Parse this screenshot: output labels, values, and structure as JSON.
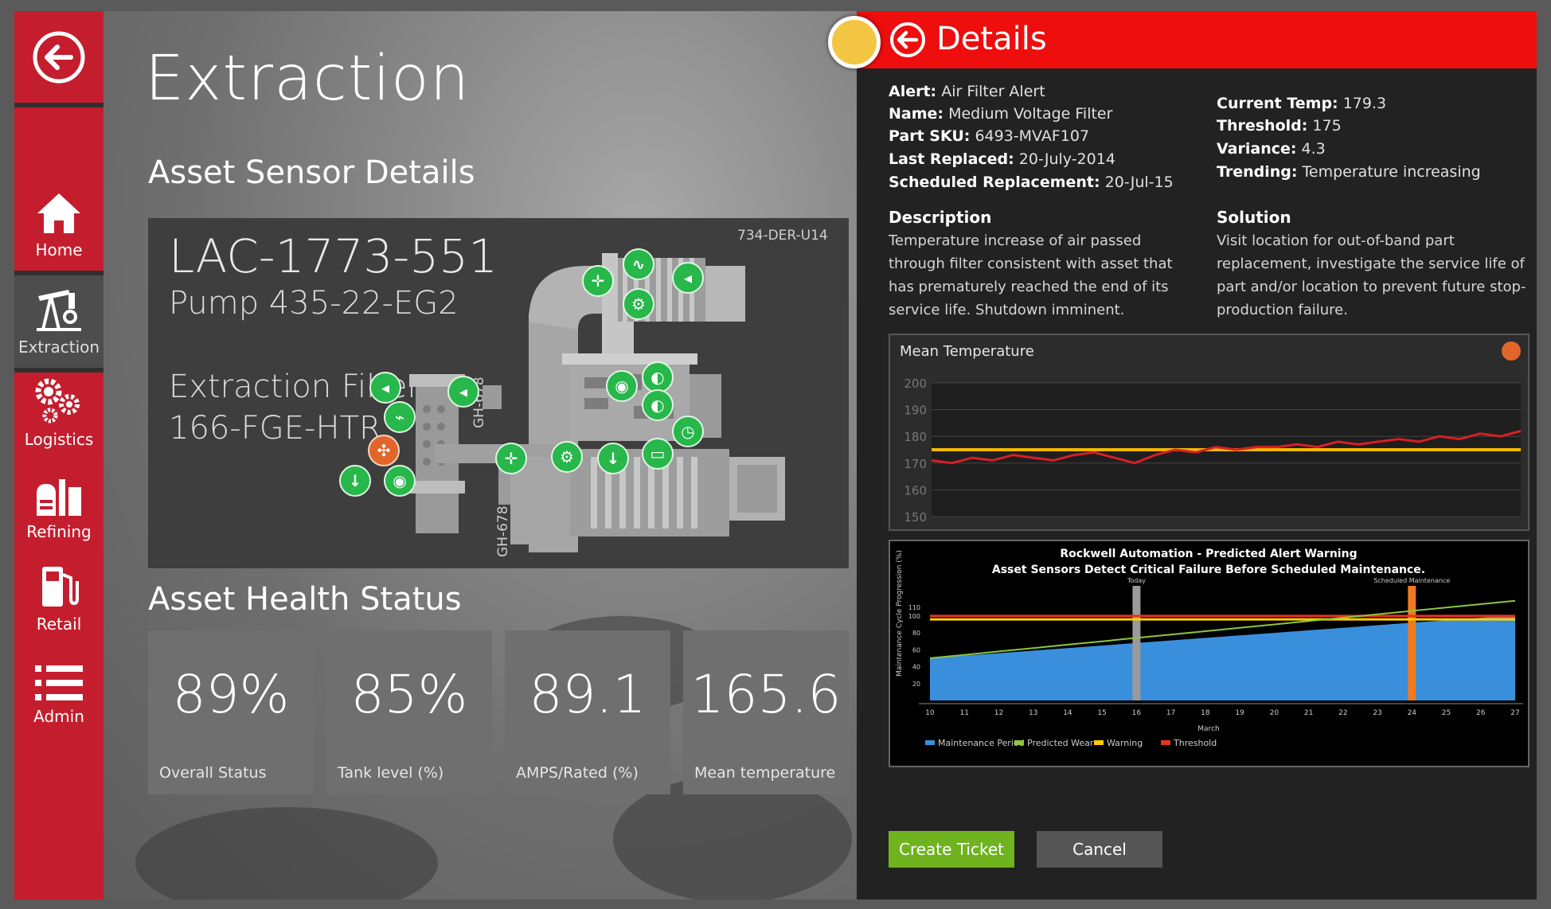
{
  "nav": {
    "items": [
      {
        "label": "Home",
        "icon": "home-icon"
      },
      {
        "label": "Extraction",
        "icon": "pumpjack-icon"
      },
      {
        "label": "Logistics",
        "icon": "gears-icon"
      },
      {
        "label": "Refining",
        "icon": "refinery-icon"
      },
      {
        "label": "Retail",
        "icon": "fuel-pump-icon"
      },
      {
        "label": "Admin",
        "icon": "list-icon"
      }
    ],
    "active": "Extraction"
  },
  "page": {
    "title": "Extraction",
    "sensor_section": "Asset Sensor Details",
    "health_section": "Asset Health Status"
  },
  "asset": {
    "id": "LAC-1773-551",
    "pump": "Pump 435-22-EG2",
    "filter_line1": "Extraction Filter",
    "filter_line2": "166-FGE-HTR",
    "code_top": "734-DER-U14",
    "code_v1": "GH-678",
    "code_v2": "GH-678"
  },
  "tiles": [
    {
      "value": "89%",
      "label": "Overall Status"
    },
    {
      "value": "85%",
      "label": "Tank level (%)"
    },
    {
      "value": "89.1",
      "label": "AMPS/Rated (%)"
    },
    {
      "value": "165.6",
      "label": "Mean temperature"
    }
  ],
  "details": {
    "title": "Details",
    "alert": {
      "k": "Alert:",
      "v": "Air Filter Alert"
    },
    "name": {
      "k": "Name:",
      "v": "Medium Voltage Filter"
    },
    "sku": {
      "k": "Part SKU:",
      "v": "6493-MVAF107"
    },
    "replaced": {
      "k": "Last Replaced:",
      "v": "20-July-2014"
    },
    "scheduled": {
      "k": "Scheduled Replacement:",
      "v": "20-Jul-15"
    },
    "temp": {
      "k": "Current Temp:",
      "v": "179.3"
    },
    "threshold": {
      "k": "Threshold:",
      "v": "175"
    },
    "variance": {
      "k": "Variance:",
      "v": "4.3"
    },
    "trending": {
      "k": "Trending:",
      "v": "Temperature increasing"
    },
    "description_title": "Description",
    "description": "Temperature increase of air passed through filter consistent with asset that has prematurely reached the end of its service life. Shutdown imminent.",
    "solution_title": "Solution",
    "solution": "Visit location for out-of-band part replacement, investigate the service life of part and/or location to prevent future stop-production failure."
  },
  "buttons": {
    "create": "Create Ticket",
    "cancel": "Cancel"
  },
  "colors": {
    "nav_red": "#c41e2e",
    "header_red": "#ee0e0e",
    "sensor_green": "#27b74a",
    "sensor_orange": "#e2662a",
    "create_green": "#6fb31f",
    "indicator_yellow": "#f4c542"
  },
  "chart_data": [
    {
      "type": "line",
      "title": "Mean Temperature",
      "ylim": [
        150,
        200
      ],
      "yticks": [
        200,
        190,
        180,
        170,
        160,
        150
      ],
      "threshold": 175,
      "series": [
        {
          "values": [
            171,
            170,
            172,
            171,
            173,
            172,
            171,
            173,
            174,
            172,
            170,
            173,
            175,
            174,
            176,
            175,
            176,
            176,
            177,
            176,
            178,
            177,
            178,
            179,
            178,
            180,
            179,
            181,
            180,
            182
          ]
        }
      ]
    },
    {
      "type": "area",
      "title": "Rockwell Automation - Predicted Alert Warning",
      "subtitle": "Asset Sensors Detect Critical Failure Before Scheduled Maintenance.",
      "ylabel": "Maintenance Cycle Progression (%)",
      "xlabel": "March",
      "x": [
        10,
        11,
        12,
        13,
        14,
        15,
        16,
        17,
        18,
        19,
        20,
        21,
        22,
        23,
        24,
        25,
        26,
        27
      ],
      "yticks": [
        20,
        40,
        60,
        80,
        100,
        110
      ],
      "markers": [
        {
          "x": 16,
          "label": "Today"
        },
        {
          "x": 24,
          "label": "Scheduled Maintenance"
        }
      ],
      "series": [
        {
          "name": "Maintenance Period",
          "values": [
            50,
            53,
            56,
            59,
            62,
            65,
            68,
            71,
            74,
            77,
            80,
            83,
            86,
            89,
            92,
            95,
            98,
            101
          ]
        },
        {
          "name": "Predicted Wear",
          "values": [
            50,
            54,
            58,
            62,
            66,
            70,
            74,
            78,
            82,
            86,
            90,
            94,
            98,
            102,
            106,
            110,
            114,
            118
          ]
        },
        {
          "name": "Warning",
          "values": [
            96,
            96,
            96,
            96,
            96,
            96,
            96,
            96,
            96,
            96,
            96,
            96,
            96,
            96,
            96,
            96,
            96,
            96
          ]
        },
        {
          "name": "Threshold",
          "values": [
            100,
            100,
            100,
            100,
            100,
            100,
            100,
            100,
            100,
            100,
            100,
            100,
            100,
            100,
            100,
            100,
            100,
            100
          ]
        }
      ]
    }
  ]
}
